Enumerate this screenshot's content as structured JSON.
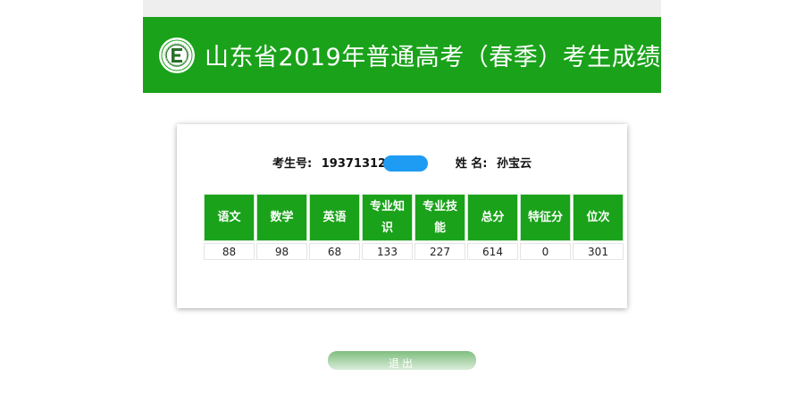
{
  "banner": {
    "title": "山东省2019年普通高考（春季）考生成绩",
    "logo_icon": "provincial-exam-seal-icon"
  },
  "candidate": {
    "id_label": "考生号:",
    "id_value": "19371312",
    "name_label": "姓 名:",
    "name_value": "孙宝云"
  },
  "scores": {
    "headers": [
      "语文",
      "数学",
      "英语",
      "专业知识",
      "专业技能",
      "总分",
      "特征分",
      "位次"
    ],
    "values": [
      "88",
      "98",
      "68",
      "133",
      "227",
      "614",
      "0",
      "301"
    ]
  },
  "exit_button": {
    "label": "退出"
  },
  "colors": {
    "brand_green": "#1aa21a",
    "redaction_blue": "#1e9bf2"
  }
}
